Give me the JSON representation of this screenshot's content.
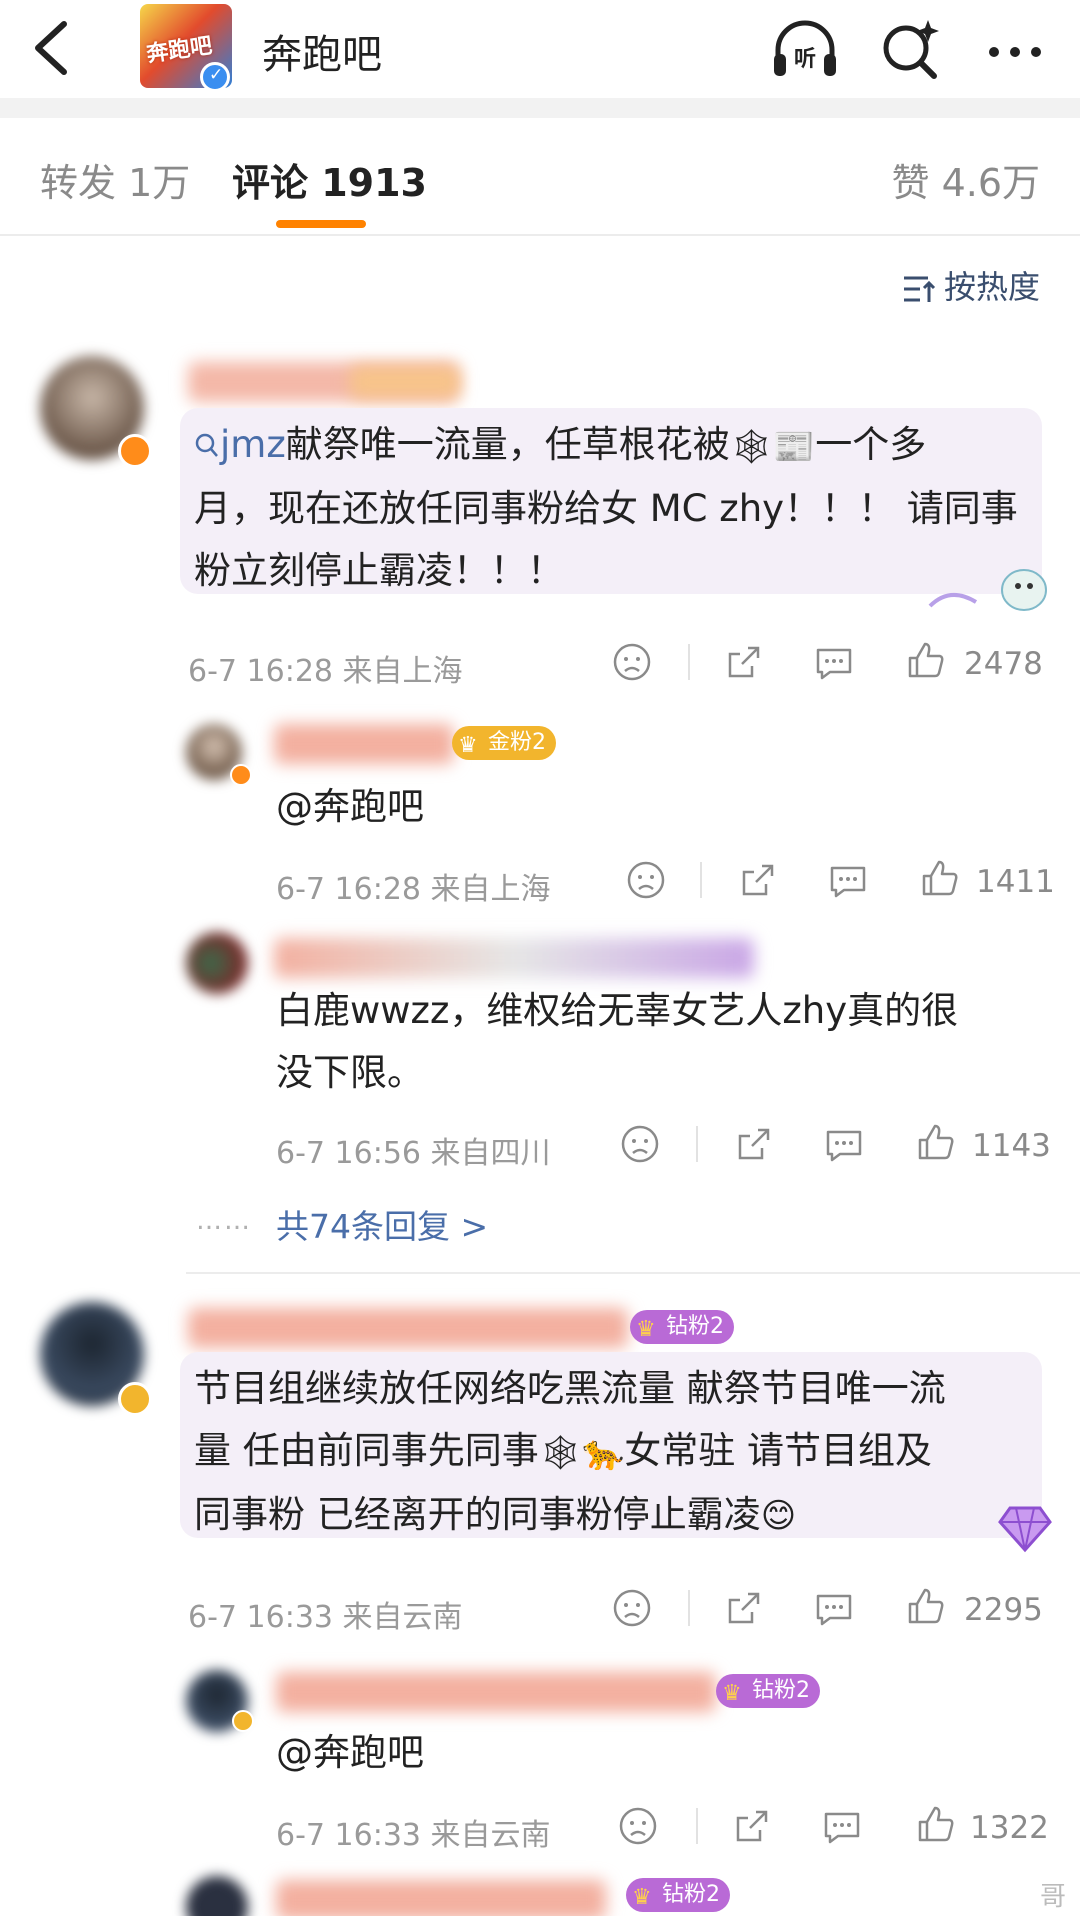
{
  "header": {
    "title": "奔跑吧",
    "logo_alt": "奔跑吧 KEEP RUNNING",
    "logo_text": "奔跑吧",
    "icons": [
      "back-arrow-icon",
      "headphones-listen-icon",
      "search-sparkle-icon",
      "more-dots-icon"
    ],
    "listen_label": "听"
  },
  "tabs": {
    "repost": "转发 1万",
    "comments": "评论 1913",
    "likes": "赞 4.6万"
  },
  "sort_label": "按热度",
  "colors": {
    "accent": "#ff8200",
    "link": "#4a6ea9",
    "bubble": "#f4eff8"
  },
  "comments": [
    {
      "text_link": "jmz",
      "text_line1": "献祭唯一流量，任草根花被",
      "text_line1_tail": "一个多",
      "text_line2": "月，现在还放任同事粉给女 MC zhy！！！ 请同事",
      "text_line3": "粉立刻停止霸凌！！！",
      "meta": "6-7 16:28  来自上海",
      "likes": "2478",
      "badge": "2",
      "replies": [
        {
          "fan_badge": "金粉2",
          "text": "@奔跑吧",
          "meta": "6-7 16:28  来自上海",
          "likes": "1411"
        },
        {
          "text_line1": "白鹿wwzz，维权给无辜女艺人zhy真的很",
          "text_line2": "没下限。",
          "meta": "6-7 16:56  来自四川",
          "likes": "1143"
        }
      ],
      "more_replies": "共74条回复 >",
      "more_dots": "……"
    },
    {
      "fan_badge": "钻粉2",
      "text_line1": "节目组继续放任网络吃黑流量 献祭节目唯一流",
      "text_line2a": "量 任由前同事先同事",
      "text_line2b": "女常驻 请节目组及",
      "text_line3": "同事粉 已经离开的同事粉停止霸凌",
      "meta": "6-7 16:33  来自云南",
      "likes": "2295",
      "replies": [
        {
          "fan_badge": "钻粉2",
          "text": "@奔跑吧",
          "meta": "6-7 16:33  来自云南",
          "likes": "1322"
        }
      ]
    }
  ],
  "partial_badge": "钻粉2",
  "watermark_hint": "哥"
}
